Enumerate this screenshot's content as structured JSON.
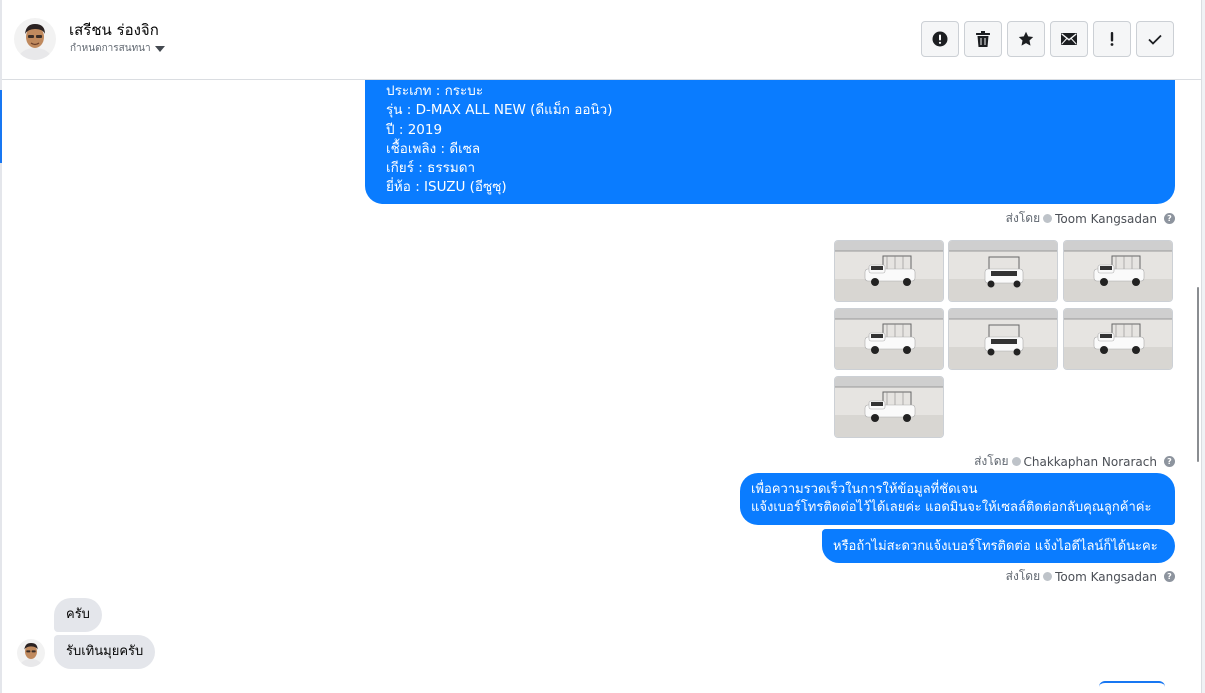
{
  "header": {
    "contact_name": "เสรีชน ร่องจิก",
    "status_label": "กำหนดการสนทนา",
    "toolbar": [
      {
        "icon": "alert-circle-icon",
        "label": "Mark as spam"
      },
      {
        "icon": "trash-icon",
        "label": "Delete"
      },
      {
        "icon": "star-icon",
        "label": "Star"
      },
      {
        "icon": "envelope-icon",
        "label": "Mark as unread"
      },
      {
        "icon": "exclamation-icon",
        "label": "Follow up"
      },
      {
        "icon": "check-icon",
        "label": "Mark as done"
      }
    ]
  },
  "messages": {
    "spec_lines": [
      "ประเภท : กระบะ",
      "รุ่น : D-MAX ALL NEW (ดีแม็ก ออนิว)",
      "ปี : 2019",
      "เชื้อเพลิง : ดีเซล",
      "เกียร์ : ธรรมดา",
      "ยี่ห้อ : ISUZU (อีซูซุ)"
    ],
    "sent_by_prefix": "ส่งโดย",
    "sender_1": "Toom Kangsadan",
    "sender_2": "Chakkaphan Norarach",
    "sender_3": "Toom Kangsadan",
    "photos_count": 7,
    "bubble_2_lines": [
      "เพื่อความรวดเร็วในการให้ข้อมูลที่ชัดเจน",
      "แจ้งเบอร์โทรติดต่อไว้ได้เลยค่ะ แอดมินจะให้เซลล์ติดต่อกลับคุณลูกค้าค่ะ"
    ],
    "bubble_3": "หรือถ้าไม่สะดวกแจ้งเบอร์โทรติดต่อ แจ้งไอดีไลน์ก็ได้นะคะ",
    "incoming_1": "ครับ",
    "incoming_2": "รับเทินมุยครับ"
  },
  "colors": {
    "outgoing_bubble": "#0a7cff",
    "incoming_bubble": "#e4e6eb",
    "accent": "#1877f2"
  }
}
